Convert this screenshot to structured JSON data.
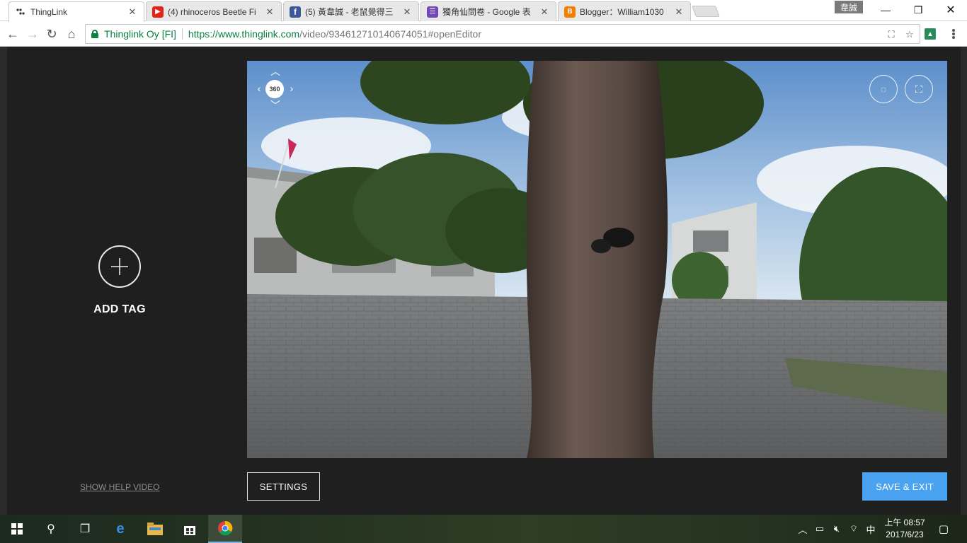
{
  "browser": {
    "tabs": [
      {
        "title": "ThingLink",
        "active": true,
        "favicon": "thinglink-icon"
      },
      {
        "title": "(4) rhinoceros Beetle Fi",
        "active": false,
        "favicon": "youtube-icon"
      },
      {
        "title": "(5) 黃韋誠 - 老鼠覺得三",
        "active": false,
        "favicon": "facebook-icon"
      },
      {
        "title": "獨角仙問卷 - Google 表",
        "active": false,
        "favicon": "google-forms-icon"
      },
      {
        "title": "Blogger：William1030",
        "active": false,
        "favicon": "blogger-icon"
      }
    ],
    "user_badge": "韋誠",
    "secure_label": "Thinglink Oy [FI]",
    "url_host": "https://www.thinglink.com",
    "url_path": "/video/934612710140674051#openEditor"
  },
  "editor": {
    "add_tag_label": "ADD TAG",
    "help_link": "SHOW HELP VIDEO",
    "badge_360": "360",
    "settings_label": "SETTINGS",
    "save_label": "SAVE & EXIT"
  },
  "taskbar": {
    "time": "上午 08:57",
    "date": "2017/6/23",
    "ime": "中"
  },
  "colors": {
    "accent": "#4aa3f0",
    "page_bg": "#1f1f1f",
    "secure_green": "#0b8043"
  }
}
